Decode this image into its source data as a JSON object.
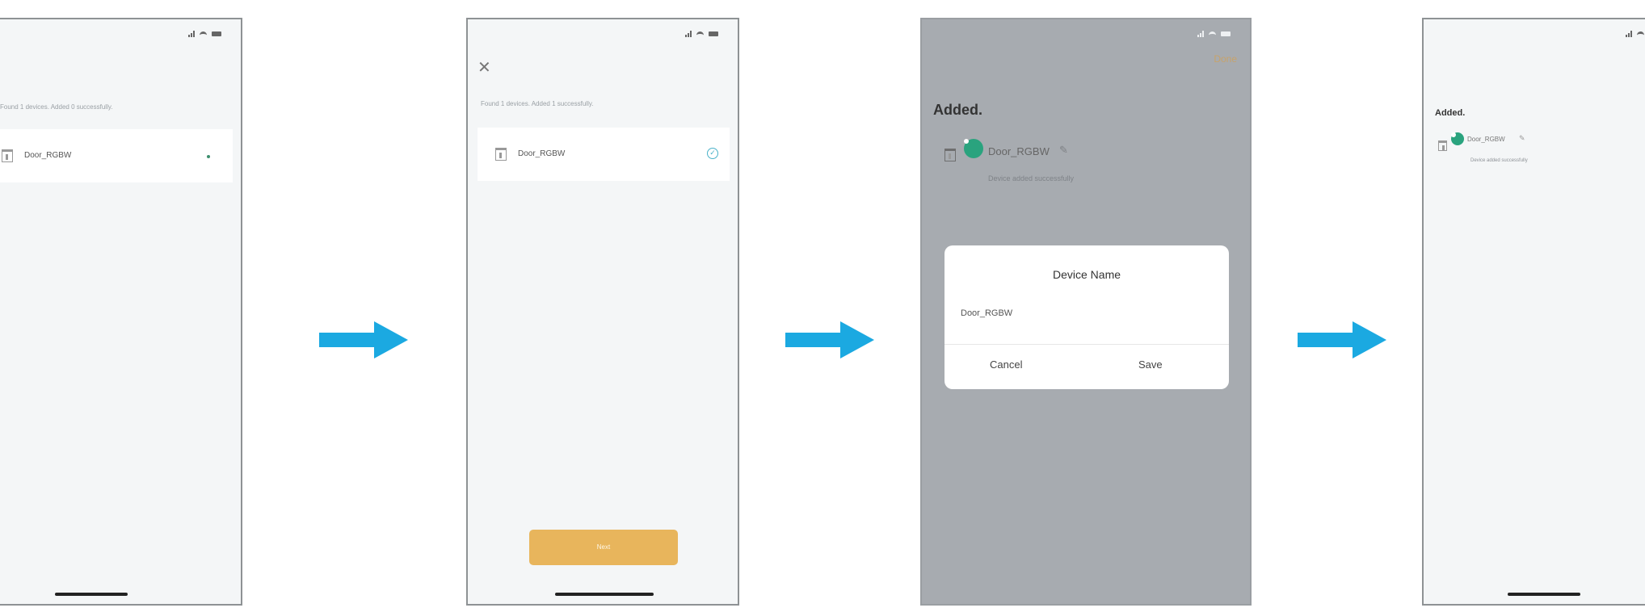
{
  "accent_colors": {
    "arrow": "#1ba9e1",
    "next_button": "#e8b55c",
    "done": "#c7a36b",
    "success_badge": "#2aa37e"
  },
  "screen1": {
    "found_text": "Found 1 devices. Added 0 successfully.",
    "device_name": "Door_RGBW"
  },
  "screen2": {
    "close_glyph": "✕",
    "found_text": "Found 1 devices. Added 1 successfully.",
    "device_name": "Door_RGBW",
    "next_label": "Next"
  },
  "screen3": {
    "done_label": "Done",
    "added_title": "Added.",
    "device_name": "Door_RGBW",
    "added_sub": "Device added successfully",
    "dialog": {
      "title": "Device Name",
      "input_value": "Door_RGBW",
      "cancel_label": "Cancel",
      "save_label": "Save"
    }
  },
  "screen4": {
    "added_title": "Added.",
    "device_name": "Door_RGBW",
    "added_sub": "Device added successfully"
  }
}
